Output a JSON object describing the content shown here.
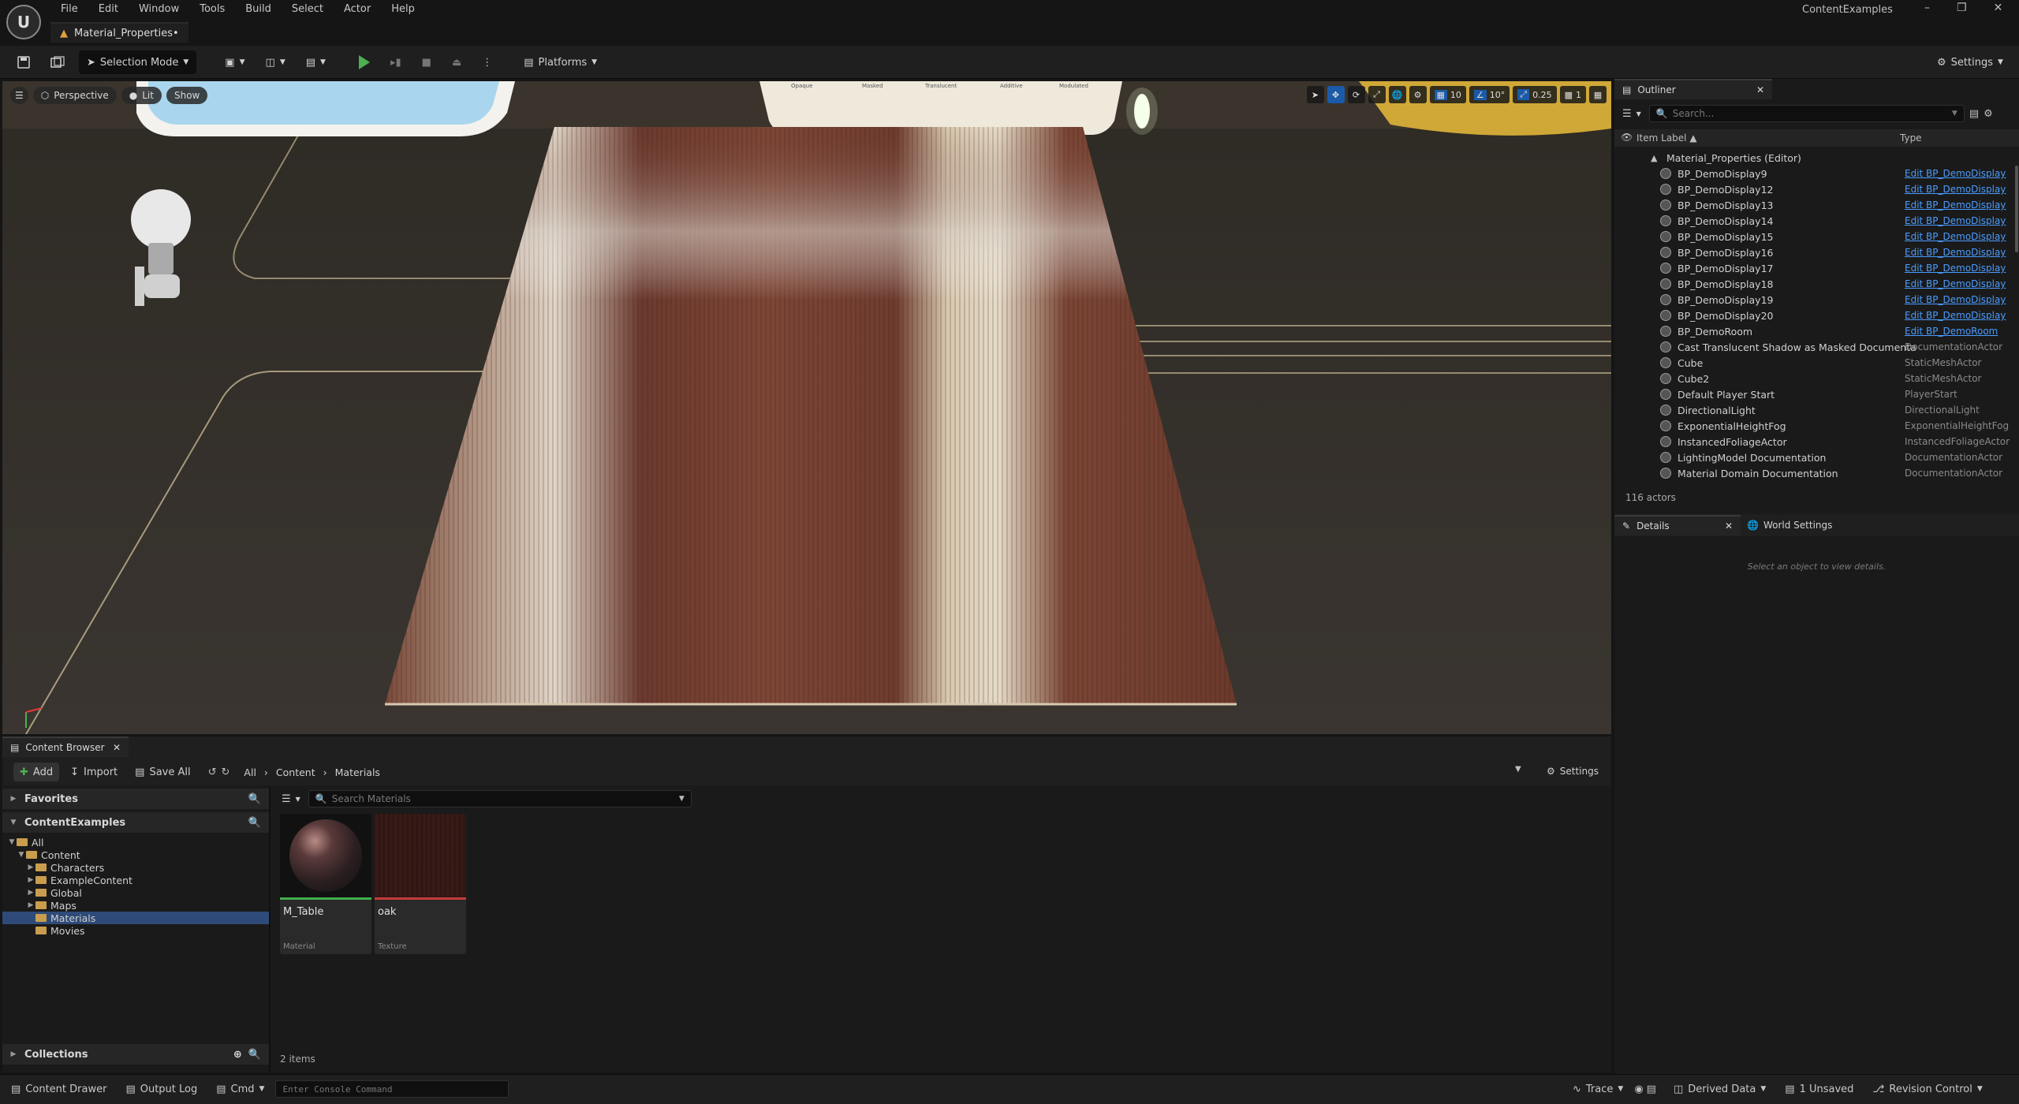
{
  "menu": [
    "File",
    "Edit",
    "Window",
    "Tools",
    "Build",
    "Select",
    "Actor",
    "Help"
  ],
  "level_tab": "Material_Properties•",
  "project_name": "ContentExamples",
  "toolbar": {
    "selection_mode": "Selection Mode",
    "platforms": "Platforms",
    "settings": "Settings"
  },
  "viewport": {
    "perspective": "Perspective",
    "lit": "Lit",
    "show": "Show",
    "grid_snap": "10",
    "rotation_snap": "10°",
    "scale_snap": "0.25",
    "camera_speed": "1",
    "sign_labels": [
      "Opaque",
      "Masked",
      "Translucent",
      "Additive",
      "Modulated"
    ]
  },
  "outliner": {
    "tab": "Outliner",
    "search_placeholder": "Search...",
    "col_label": "Item Label ▲",
    "col_type": "Type",
    "root": "Material_Properties (Editor)",
    "rows": [
      {
        "name": "BP_DemoDisplay9",
        "type": "Edit BP_DemoDisplay",
        "link": true
      },
      {
        "name": "BP_DemoDisplay12",
        "type": "Edit BP_DemoDisplay",
        "link": true
      },
      {
        "name": "BP_DemoDisplay13",
        "type": "Edit BP_DemoDisplay",
        "link": true
      },
      {
        "name": "BP_DemoDisplay14",
        "type": "Edit BP_DemoDisplay",
        "link": true
      },
      {
        "name": "BP_DemoDisplay15",
        "type": "Edit BP_DemoDisplay",
        "link": true
      },
      {
        "name": "BP_DemoDisplay16",
        "type": "Edit BP_DemoDisplay",
        "link": true
      },
      {
        "name": "BP_DemoDisplay17",
        "type": "Edit BP_DemoDisplay",
        "link": true
      },
      {
        "name": "BP_DemoDisplay18",
        "type": "Edit BP_DemoDisplay",
        "link": true
      },
      {
        "name": "BP_DemoDisplay19",
        "type": "Edit BP_DemoDisplay",
        "link": true
      },
      {
        "name": "BP_DemoDisplay20",
        "type": "Edit BP_DemoDisplay",
        "link": true
      },
      {
        "name": "BP_DemoRoom",
        "type": "Edit BP_DemoRoom",
        "link": true
      },
      {
        "name": "Cast Translucent Shadow as Masked Documenta",
        "type": "DocumentationActor",
        "link": false
      },
      {
        "name": "Cube",
        "type": "StaticMeshActor",
        "link": false
      },
      {
        "name": "Cube2",
        "type": "StaticMeshActor",
        "link": false
      },
      {
        "name": "Default Player Start",
        "type": "PlayerStart",
        "link": false
      },
      {
        "name": "DirectionalLight",
        "type": "DirectionalLight",
        "link": false
      },
      {
        "name": "ExponentialHeightFog",
        "type": "ExponentialHeightFog",
        "link": false
      },
      {
        "name": "InstancedFoliageActor",
        "type": "InstancedFoliageActor",
        "link": false
      },
      {
        "name": "LightingModel Documentation",
        "type": "DocumentationActor",
        "link": false
      },
      {
        "name": "Material Domain Documentation",
        "type": "DocumentationActor",
        "link": false
      }
    ],
    "actor_count": "116 actors"
  },
  "details": {
    "tab": "Details",
    "world_tab": "World Settings",
    "empty_msg": "Select an object to view details."
  },
  "content_browser": {
    "tab": "Content Browser",
    "add": "Add",
    "import": "Import",
    "save_all": "Save All",
    "path": [
      "All",
      "Content",
      "Materials"
    ],
    "settings": "Settings",
    "search_placeholder": "Search Materials",
    "favorites": "Favorites",
    "project": "ContentExamples",
    "tree": [
      {
        "label": "All",
        "depth": 0,
        "open": true
      },
      {
        "label": "Content",
        "depth": 1,
        "open": true
      },
      {
        "label": "Characters",
        "depth": 2,
        "open": false
      },
      {
        "label": "ExampleContent",
        "depth": 2,
        "open": false
      },
      {
        "label": "Global",
        "depth": 2,
        "open": false
      },
      {
        "label": "Maps",
        "depth": 2,
        "open": false
      },
      {
        "label": "Materials",
        "depth": 2,
        "open": null,
        "selected": true
      },
      {
        "label": "Movies",
        "depth": 2,
        "open": null
      }
    ],
    "collections": "Collections",
    "assets": [
      {
        "name": "M_Table",
        "type": "Material",
        "bar_color": "#3fae4a"
      },
      {
        "name": "oak",
        "type": "Texture",
        "bar_color": "#c43b3b"
      }
    ],
    "item_count": "2 items"
  },
  "statusbar": {
    "content_drawer": "Content Drawer",
    "output_log": "Output Log",
    "cmd": "Cmd",
    "console_placeholder": "Enter Console Command",
    "trace": "Trace",
    "derived_data": "Derived Data",
    "unsaved": "1 Unsaved",
    "revision_control": "Revision Control"
  },
  "colors": {
    "accent_blue": "#1b5aa8",
    "link_blue": "#4a9cff",
    "play_green": "#4caf50",
    "selection": "#2e4a78"
  }
}
